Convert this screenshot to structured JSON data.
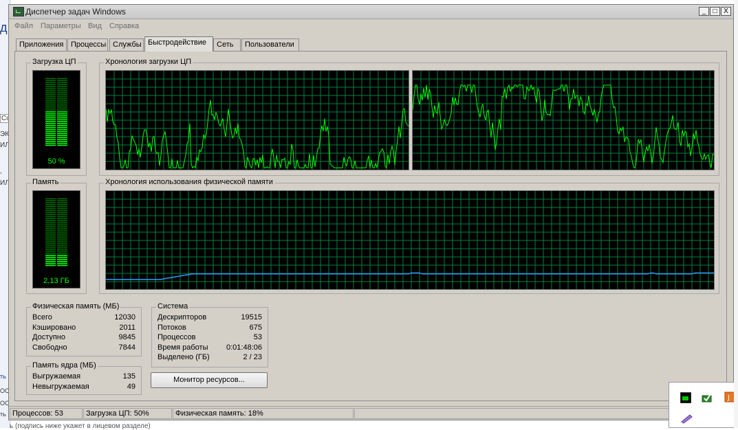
{
  "window": {
    "title": "Диспетчер задач Windows",
    "controls": {
      "minimize": "_",
      "maximize": "□",
      "close": "X"
    }
  },
  "menu": [
    "Файл",
    "Параметры",
    "Вид",
    "Справка"
  ],
  "tabs": [
    "Приложения",
    "Процессы",
    "Службы",
    "Быстродействие",
    "Сеть",
    "Пользователи"
  ],
  "active_tab": "Быстродействие",
  "cpu": {
    "group_label": "Загрузка ЦП",
    "value_label": "50 %",
    "level": 0.5,
    "history_label": "Хронология загрузки ЦП"
  },
  "memory": {
    "group_label": "Память",
    "value_label": "2,13 ГБ",
    "level": 0.18,
    "history_label": "Хронология использования физической памяти"
  },
  "phys_mem": {
    "title": "Физическая память (МБ)",
    "rows": [
      {
        "label": "Всего",
        "value": "12030"
      },
      {
        "label": "Кэшировано",
        "value": "2011"
      },
      {
        "label": "Доступно",
        "value": "9845"
      },
      {
        "label": "Свободно",
        "value": "7844"
      }
    ]
  },
  "kernel_mem": {
    "title": "Память ядра (МБ)",
    "rows": [
      {
        "label": "Выгружаемая",
        "value": "135"
      },
      {
        "label": "Невыгружаемая",
        "value": "49"
      }
    ]
  },
  "system": {
    "title": "Система",
    "rows": [
      {
        "label": "Дескрипторов",
        "value": "19515"
      },
      {
        "label": "Потоков",
        "value": "675"
      },
      {
        "label": "Процессов",
        "value": "53"
      },
      {
        "label": "Время работы",
        "value": "0:01:48:06"
      },
      {
        "label": "Выделено (ГБ)",
        "value": "2 / 23"
      }
    ]
  },
  "resource_monitor_button": "Монитор ресурсов...",
  "statusbar": {
    "processes": "Процессов: 53",
    "cpu": "Загрузка ЦП: 50%",
    "memory": "Физическая память: 18%"
  },
  "background": {
    "left_fragments": [
      "Co",
      "ЭК",
      "ИЛ",
      ",",
      "ИЛ",
      "ть",
      "ОС",
      "ОС",
      "ть"
    ],
    "left_header": "д",
    "bottom_text": "ь (подпись ниже укажет в лицевом разделе)"
  },
  "tray_icons": [
    "task-manager-tray-icon",
    "network-tray-icon",
    "java-tray-icon",
    "pen-tray-icon"
  ],
  "colors": {
    "graph_bg": "#000000",
    "grid": "#008040",
    "cpu_line": "#00ff00",
    "mem_line": "#3399ff",
    "meter_on": "#00ff00",
    "meter_off": "#006600"
  }
}
